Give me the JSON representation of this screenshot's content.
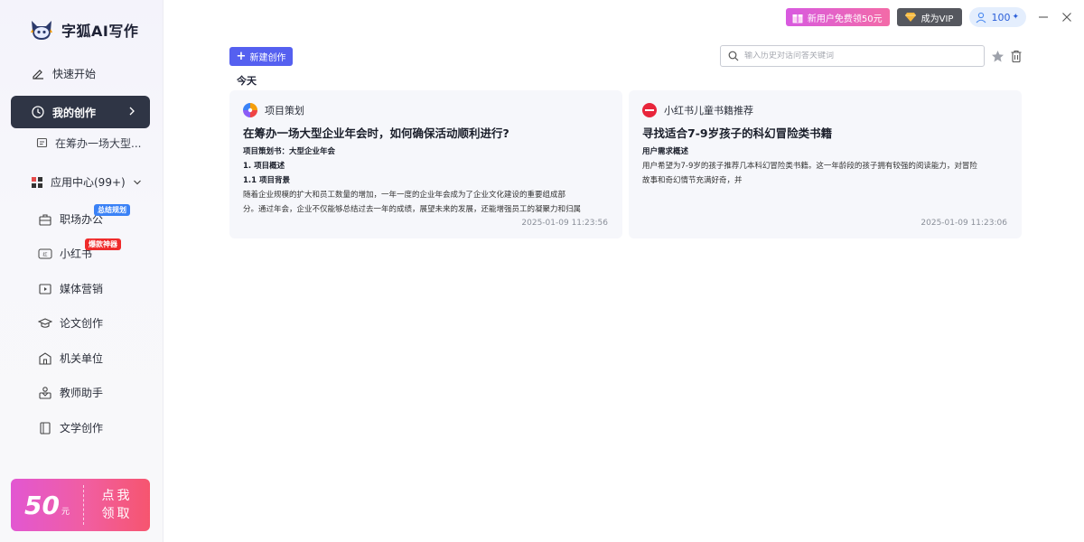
{
  "app": {
    "name": "字狐AI写作"
  },
  "sidebar": {
    "quick_start": "快速开始",
    "my_creations": "我的创作",
    "history_item": "在筹办一场大型...",
    "app_center": "应用中心(99+)",
    "categories": [
      {
        "label": "职场办公",
        "tag": "总结规划",
        "tag_color": "#3b82f6"
      },
      {
        "label": "小红书",
        "tag": "爆款神器",
        "tag_color": "#ef2b2b"
      },
      {
        "label": "媒体营销"
      },
      {
        "label": "论文创作"
      },
      {
        "label": "机关单位"
      },
      {
        "label": "教师助手"
      },
      {
        "label": "文学创作"
      }
    ],
    "promo": {
      "amount": "50",
      "unit": "元",
      "cta_line1": "点我",
      "cta_line2": "领取"
    }
  },
  "topbar": {
    "new_user": "新用户免费领50元",
    "vip": "成为VIP",
    "points": "100"
  },
  "toolbar": {
    "new_button": "新建创作",
    "search_placeholder": "输入历史对话问答关键词"
  },
  "section": "今天",
  "cards": [
    {
      "category": "项目策划",
      "title": "在筹办一场大型企业年会时，如何确保活动顺利进行?",
      "lines": [
        {
          "text": "项目策划书：大型企业年会",
          "bold": true
        },
        {
          "text": "1. 项目概述",
          "bold": true
        },
        {
          "text": "1.1 项目背景",
          "bold": true
        },
        {
          "text": "随着企业规模的扩大和员工数量的增加，一年一度的企业年会成为了企业文化建设的重要组成部",
          "bold": false
        },
        {
          "text": "分。通过年会，企业不仅能够总结过去一年的成绩，展望未来的发展，还能增强员工的凝聚力和归属",
          "bold": false
        }
      ],
      "time": "2025-01-09 11:23:56"
    },
    {
      "category": "小红书儿童书籍推荐",
      "title": "寻找适合7-9岁孩子的科幻冒险类书籍",
      "lines": [
        {
          "text": "用户需求概述",
          "bold": true
        },
        {
          "text": "用户希望为7-9岁的孩子推荐几本科幻冒险类书籍。这一年龄段的孩子拥有较强的阅读能力，对冒险",
          "bold": false
        },
        {
          "text": "故事和奇幻情节充满好奇，并",
          "bold": false
        }
      ],
      "time": "2025-01-09 11:23:06"
    }
  ],
  "colors": {
    "accent": "#5560f0",
    "active_nav": "#2f3545",
    "card_bg": "#f6f7fb"
  }
}
